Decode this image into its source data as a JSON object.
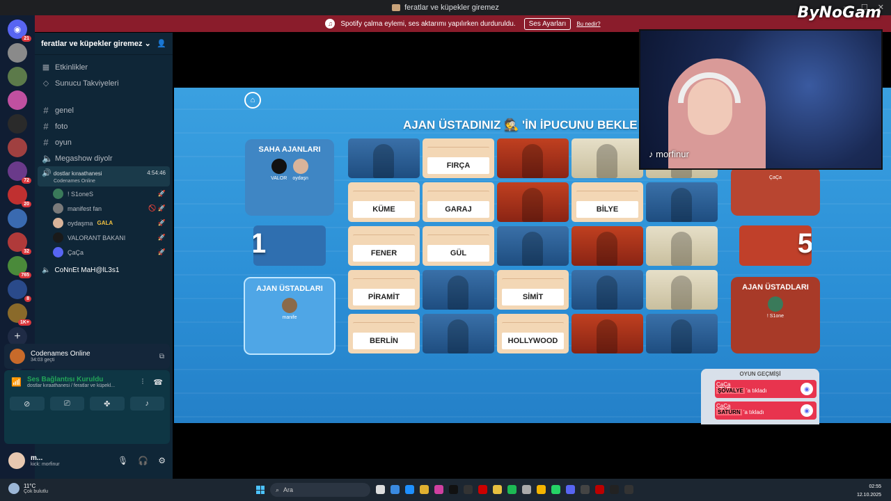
{
  "window": {
    "title": "feratlar ve küpekler giremez",
    "watermark": "ByNoGam"
  },
  "banner": {
    "text": "Spotify çalma eylemi, ses aktarımı yapılırken durduruldu.",
    "button": "Ses Ayarları",
    "link": "Bu nedir?"
  },
  "rail": {
    "badges": [
      "21",
      "72",
      "20",
      "32",
      "765",
      "8",
      "1K+"
    ]
  },
  "sidebar": {
    "server_name": "feratlar ve küpekler giremez",
    "nav": [
      {
        "icon": "calendar-icon",
        "label": "Etkinlikler"
      },
      {
        "icon": "boost-icon",
        "label": "Sunucu Takviyeleri"
      }
    ],
    "channels": [
      {
        "type": "text",
        "label": "genel"
      },
      {
        "type": "text",
        "label": "foto"
      },
      {
        "type": "text",
        "label": "oyun"
      },
      {
        "type": "voice",
        "label": "Megashow diyolr"
      }
    ],
    "active_voice": {
      "label": "dostlar kıraathanesi",
      "time": "4:54:46",
      "activity": "Codenames Online"
    },
    "members": [
      {
        "name": "! S1oneS",
        "color": "#3a7a5a"
      },
      {
        "name": "manifest fan",
        "color": "#7a7a7a"
      },
      {
        "name": "oydaşma",
        "extra": "GALA",
        "color": "#d9b49a"
      },
      {
        "name": "VALORANT BAKANI",
        "color": "#1a1a1a"
      },
      {
        "name": "ÇaÇa",
        "color": "#5865f2"
      }
    ],
    "other_voice": "CoNnEt MaH@lL3s1"
  },
  "activity_card": {
    "title": "Codenames Online",
    "subtitle": "34:03 geçti"
  },
  "voice_status": {
    "title": "Ses Bağlantısı Kuruldu",
    "subtitle": "dostlar kıraathanesi / feratlar ve küpekl..."
  },
  "user_panel": {
    "name": "m...",
    "status": "kick: morfinur"
  },
  "game": {
    "waiting_text": "AJAN ÜSTADINIZ 🕵 'İN İPUCUNU BEKLE",
    "blue_team": {
      "field_title": "SAHA AJANLARI",
      "field_members": [
        "VALOR",
        "oydaşn"
      ],
      "master_title": "AJAN ÜSTADLARI",
      "master_members": [
        "manife"
      ],
      "remaining": "1"
    },
    "red_team": {
      "field_members": [
        "ÇaÇa"
      ],
      "master_title": "AJAN ÜSTADLARI",
      "master_members": [
        "! S1one"
      ],
      "remaining": "5"
    },
    "grid": [
      [
        {
          "t": "blue"
        },
        {
          "t": "word",
          "w": "FIRÇA"
        },
        {
          "t": "red"
        },
        {
          "t": "neutral"
        },
        {
          "t": "neutral"
        }
      ],
      [
        {
          "t": "word",
          "w": "KÜME"
        },
        {
          "t": "word",
          "w": "GARAJ"
        },
        {
          "t": "red"
        },
        {
          "t": "word",
          "w": "BİLYE"
        },
        {
          "t": "blue"
        }
      ],
      [
        {
          "t": "word",
          "w": "FENER"
        },
        {
          "t": "word",
          "w": "GÜL"
        },
        {
          "t": "blue"
        },
        {
          "t": "red"
        },
        {
          "t": "neutral"
        }
      ],
      [
        {
          "t": "word",
          "w": "PİRAMİT"
        },
        {
          "t": "blue"
        },
        {
          "t": "word",
          "w": "SİMİT"
        },
        {
          "t": "blue"
        },
        {
          "t": "neutral"
        }
      ],
      [
        {
          "t": "word",
          "w": "BERLİN"
        },
        {
          "t": "blue"
        },
        {
          "t": "word",
          "w": "HOLLYWOOD"
        },
        {
          "t": "red"
        },
        {
          "t": "blue"
        }
      ]
    ],
    "history": {
      "title": "OYUN GEÇMİŞİ",
      "entries": [
        {
          "name": "ÇaÇa",
          "word": "ŞÖVALYE",
          "suffix": "'a tıkladı"
        },
        {
          "name": "ÇaÇa",
          "word": "SATÜRN",
          "suffix": "'a tıkladı"
        }
      ]
    }
  },
  "stream": {
    "handle": "morfinur"
  },
  "taskbar": {
    "temp": "11°C",
    "weather": "Çok bulutlu",
    "search": "Ara",
    "time": "02:55",
    "date": "12.10.2025"
  },
  "colors": {
    "blue_team": "#2f6fb0",
    "red_team": "#c0402a",
    "word_card": "#f3d7b5",
    "discord_bg": "#0f2637"
  }
}
